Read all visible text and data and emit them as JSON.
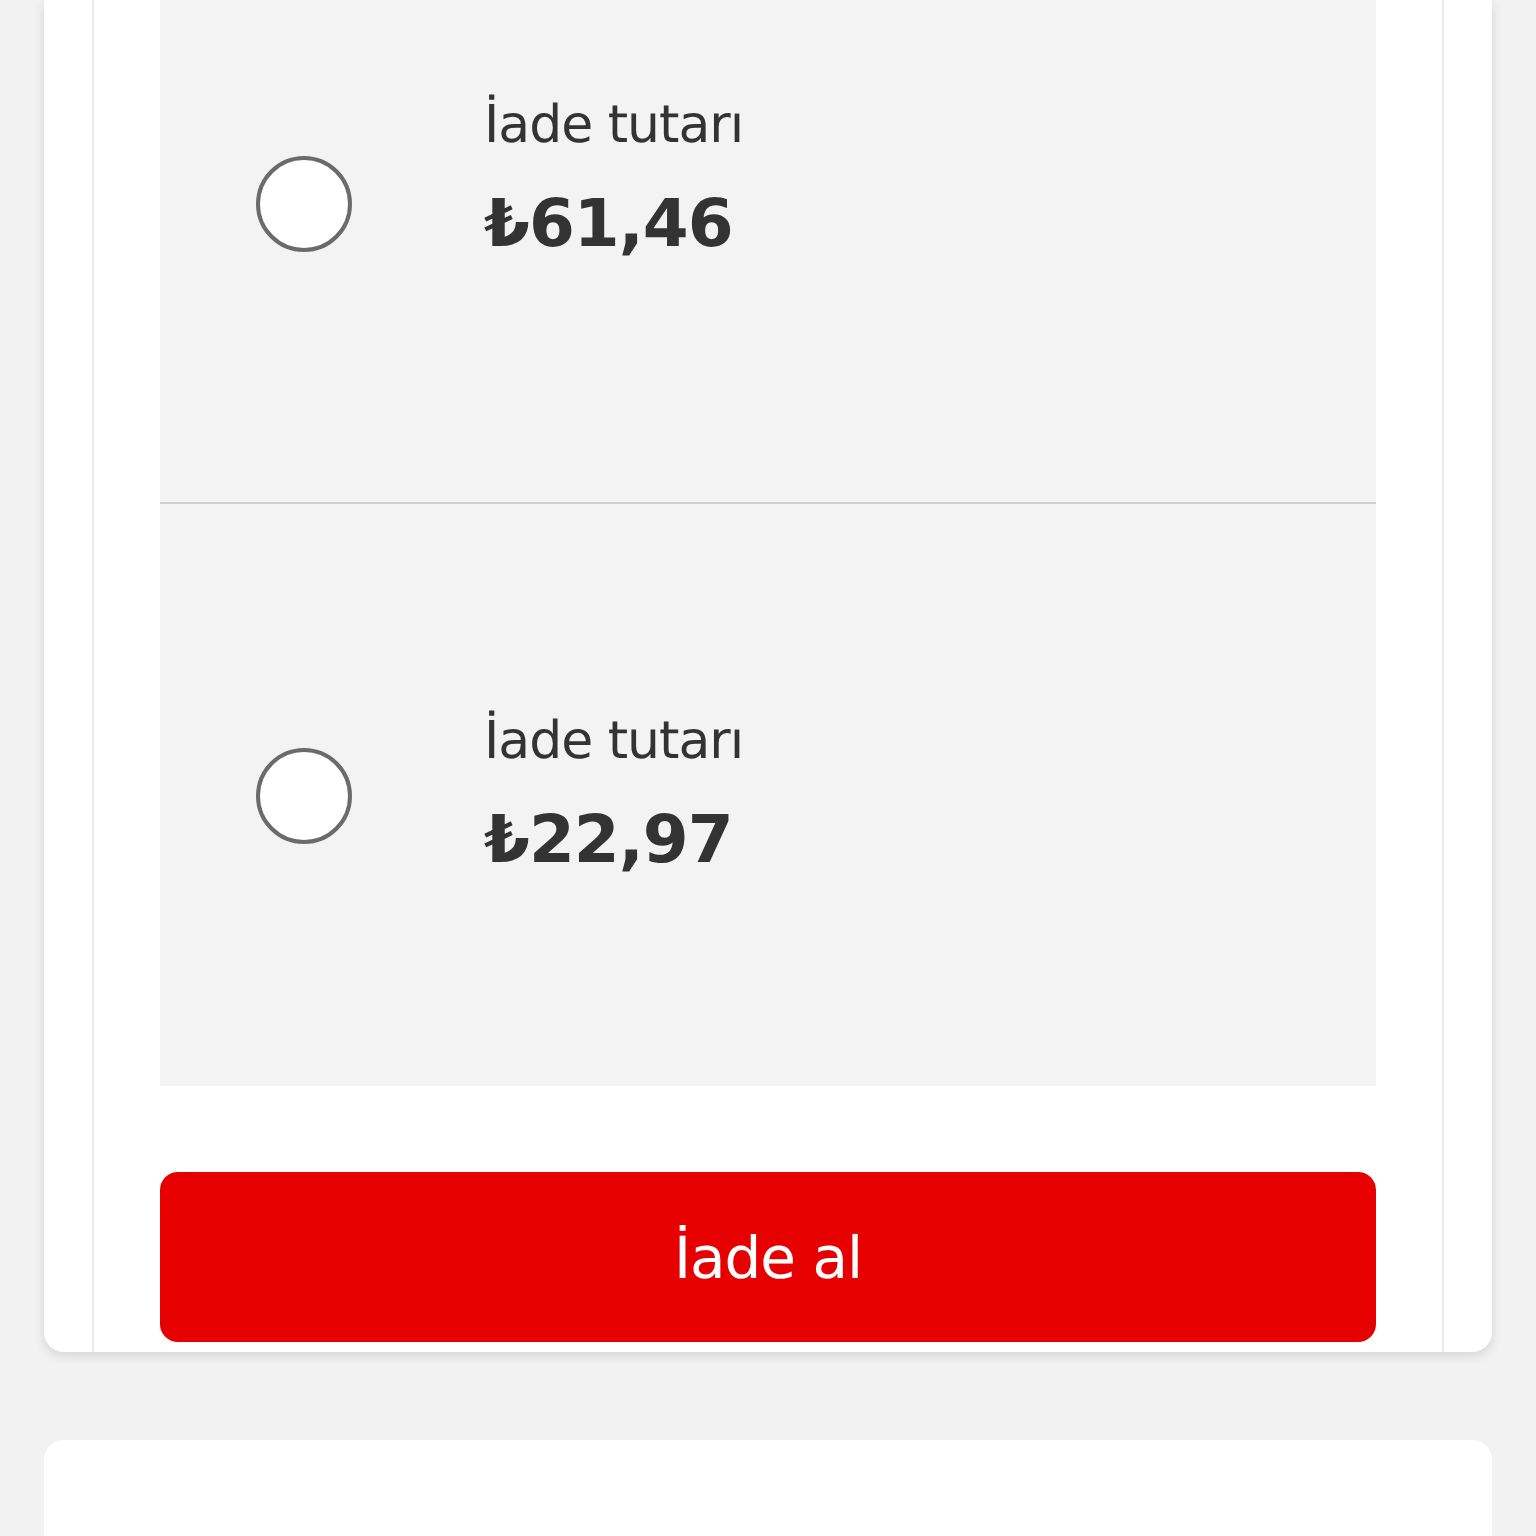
{
  "refund_options": [
    {
      "label": "İade tutarı",
      "amount": "₺61,46",
      "selected": false
    },
    {
      "label": "İade tutarı",
      "amount": "₺22,97",
      "selected": false
    }
  ],
  "action_button": {
    "label": "İade al"
  }
}
